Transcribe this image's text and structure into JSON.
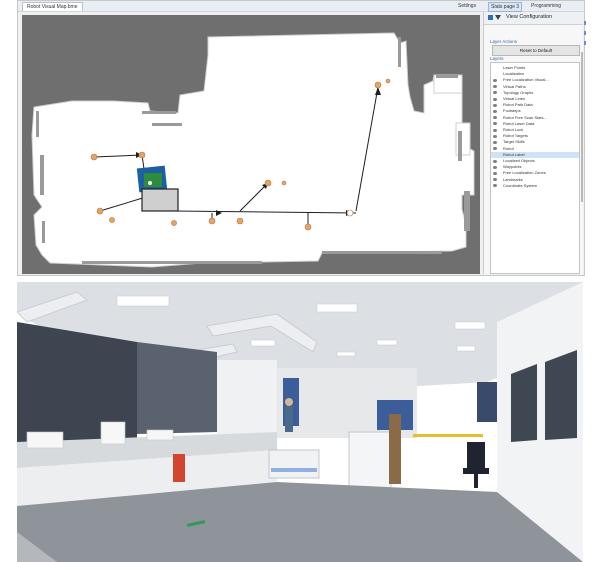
{
  "app": {
    "document_tab": "Robot Visual Map.bme",
    "top_tools": [
      "Settings",
      "Stats page 3",
      "Programming"
    ]
  },
  "sidebar": {
    "title": "View Configuration",
    "layer_actions_label": "Layer Actions",
    "reset_button": "Reset to Default",
    "layers_label": "Layers",
    "layers": [
      {
        "label": "Laser Points",
        "eye": false
      },
      {
        "label": "Localization",
        "eye": false
      },
      {
        "label": "Free Localization Visual...",
        "eye": true
      },
      {
        "label": "Virtual Paths",
        "eye": true
      },
      {
        "label": "Topology Graphs",
        "eye": true
      },
      {
        "label": "Virtual Lines",
        "eye": true
      },
      {
        "label": "Robot Path Data",
        "eye": true
      },
      {
        "label": "Footsteps",
        "eye": true
      },
      {
        "label": "Robot Free Scan Stats...",
        "eye": true
      },
      {
        "label": "Robot Laser Data",
        "eye": true
      },
      {
        "label": "Robot Lock",
        "eye": true
      },
      {
        "label": "Robot Targets",
        "eye": true
      },
      {
        "label": "Target Skills",
        "eye": true
      },
      {
        "label": "Robot",
        "eye": true
      },
      {
        "label": "Robot Label",
        "eye": false,
        "selected": true
      },
      {
        "label": "Localized Objects",
        "eye": true
      },
      {
        "label": "Waypoints",
        "eye": true
      },
      {
        "label": "Free Localization Zones",
        "eye": true
      },
      {
        "label": "Landmarks",
        "eye": true
      },
      {
        "label": "Coordinate System",
        "eye": true
      }
    ]
  },
  "colors": {
    "map_background": "#6f6f6f",
    "free_space": "#ffffff",
    "robot_body": "#1d5fa3",
    "robot_label": "#2e8b3e",
    "waypoint": "#e3a46a",
    "selection": "#cfe2f7"
  },
  "photo": {
    "description_icon": "lab-photo"
  }
}
